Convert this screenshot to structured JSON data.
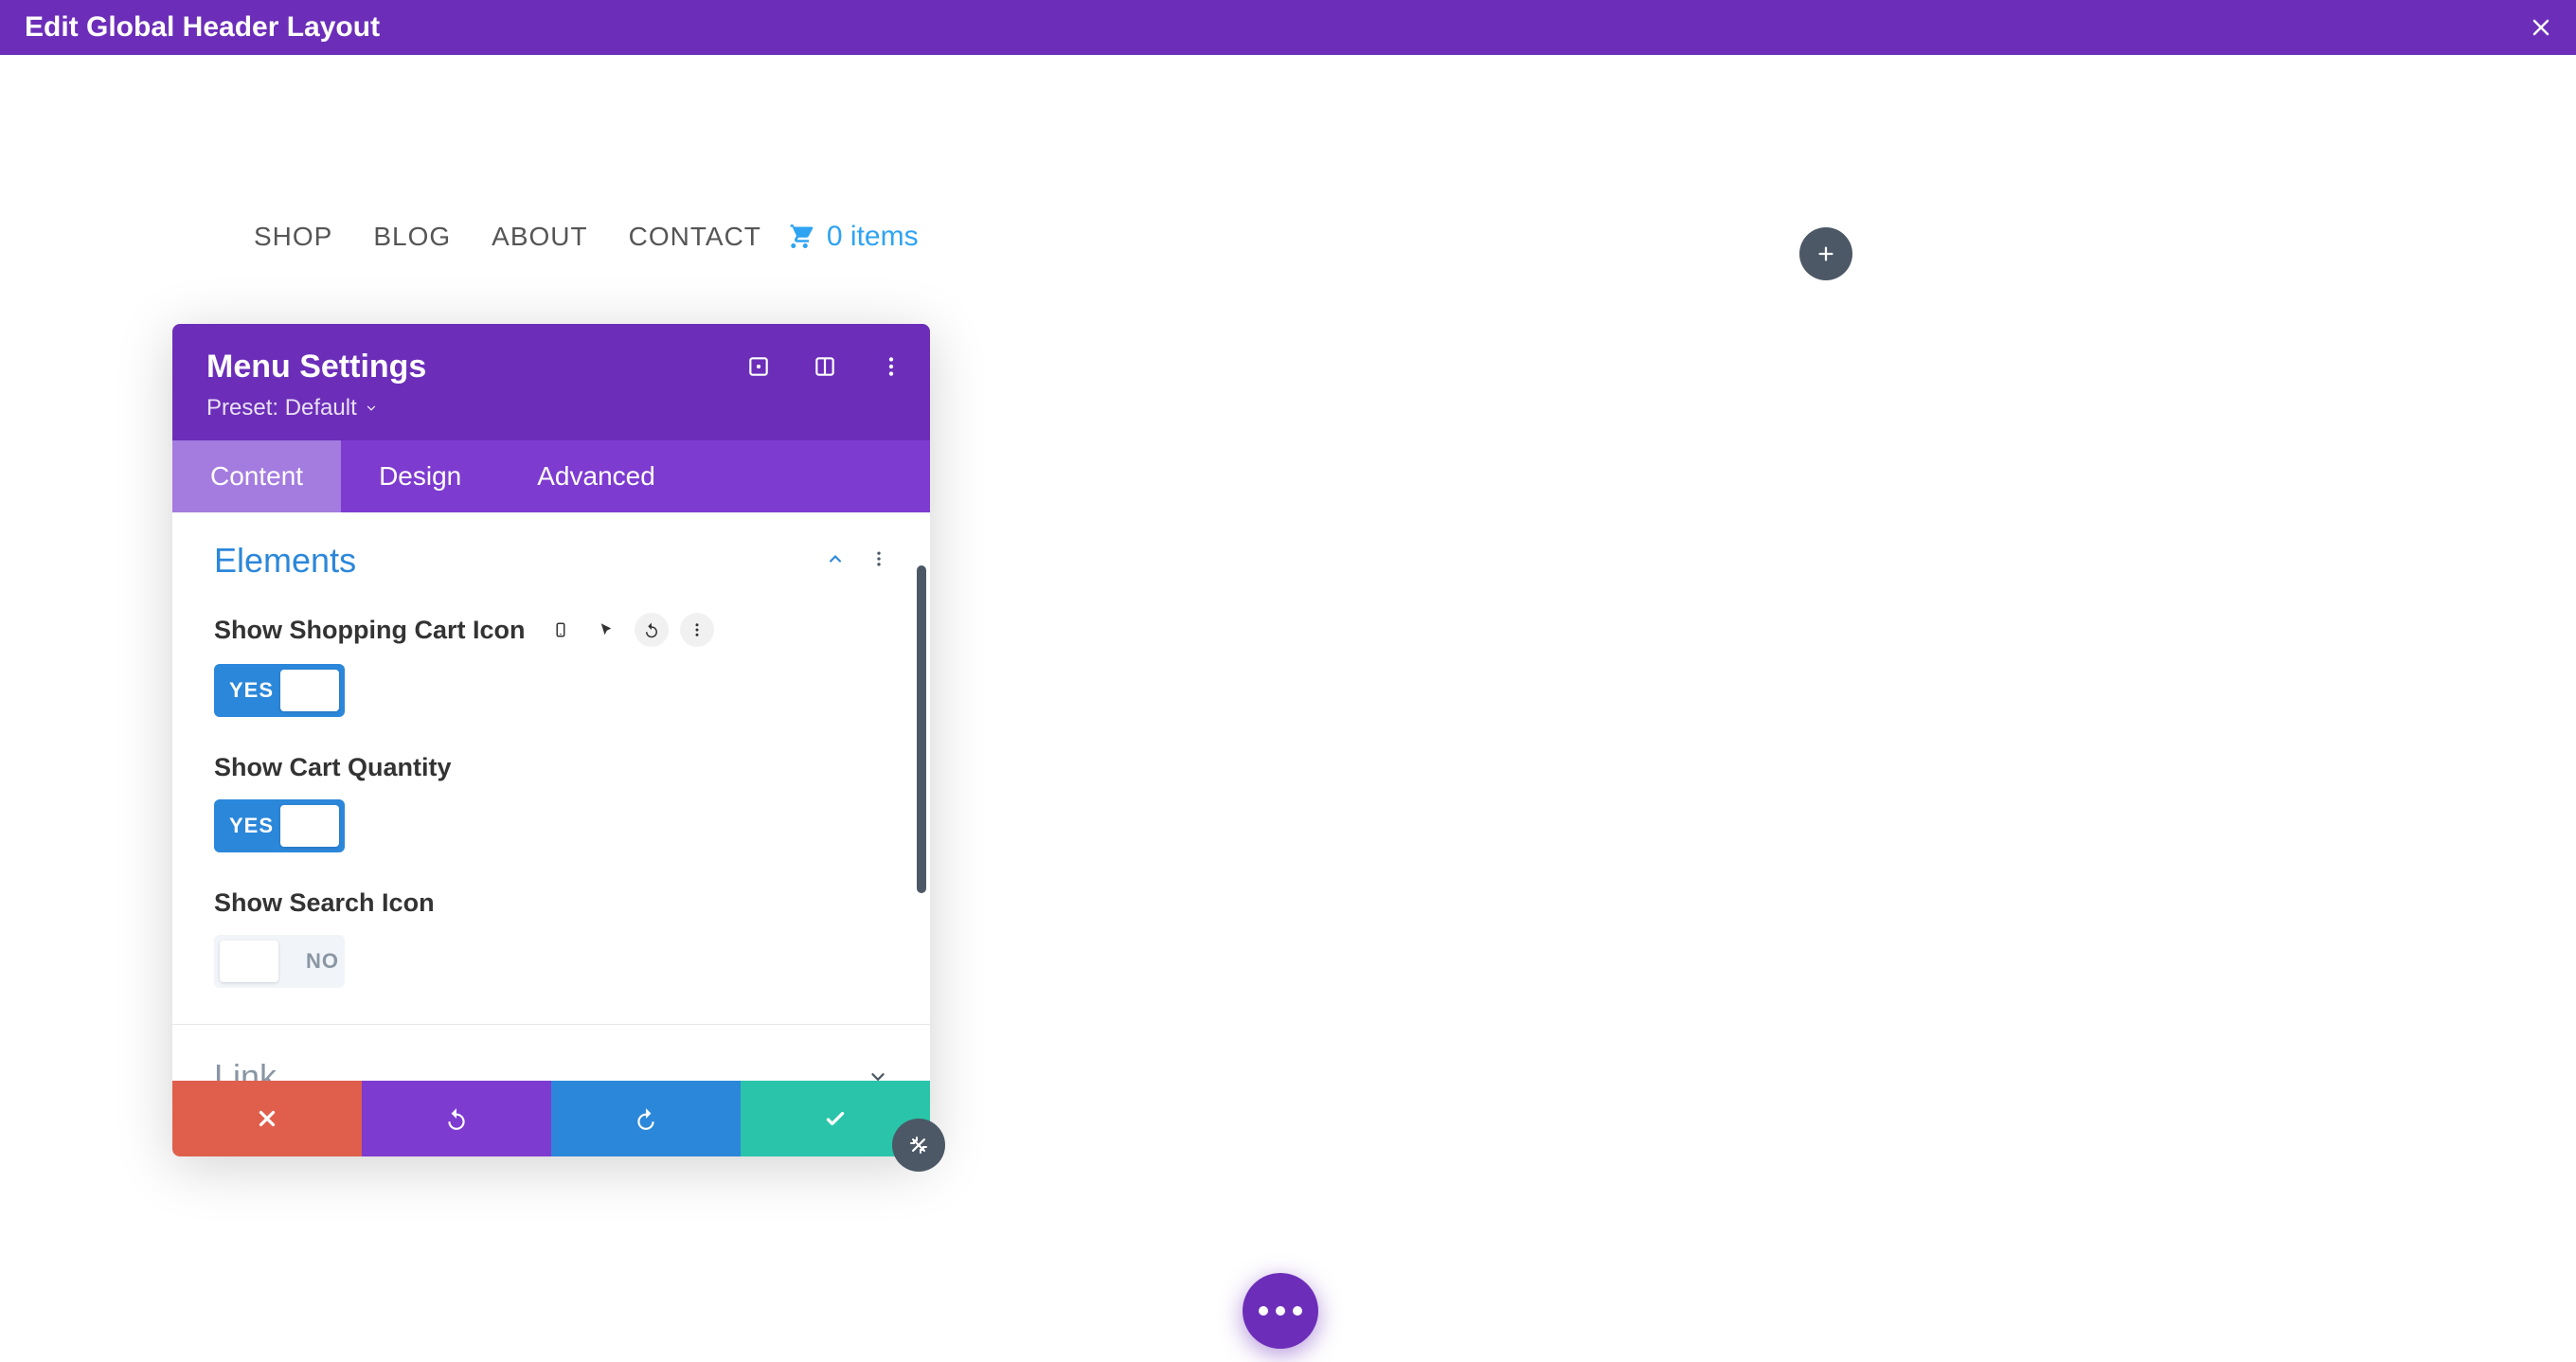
{
  "topbar": {
    "title": "Edit Global Header Layout"
  },
  "nav": {
    "items": [
      "SHOP",
      "BLOG",
      "ABOUT",
      "CONTACT"
    ],
    "cart_text": "0 items"
  },
  "panel": {
    "title": "Menu Settings",
    "preset_label": "Preset: Default",
    "tabs": {
      "content": "Content",
      "design": "Design",
      "advanced": "Advanced"
    },
    "sections": {
      "elements": {
        "title": "Elements"
      },
      "link": {
        "title": "Link"
      }
    },
    "options": {
      "cart_icon": {
        "label": "Show Shopping Cart Icon",
        "value": "YES"
      },
      "cart_qty": {
        "label": "Show Cart Quantity",
        "value": "YES"
      },
      "search": {
        "label": "Show Search Icon",
        "value": "NO"
      }
    }
  }
}
